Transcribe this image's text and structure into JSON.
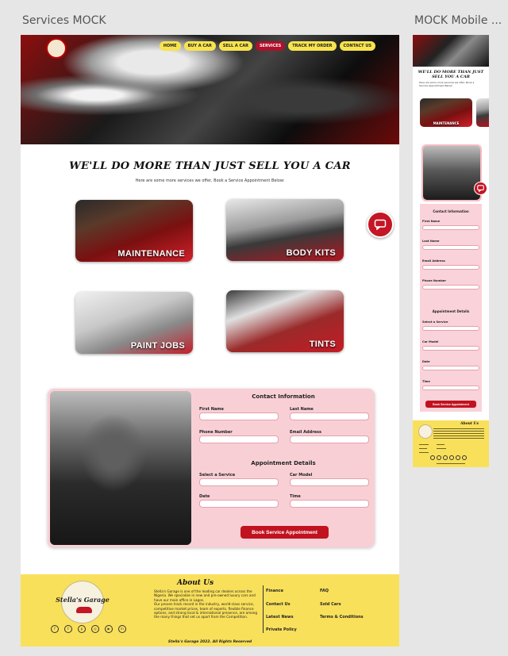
{
  "frames": {
    "desktop_title": "Services MOCK",
    "mobile_title": "MOCK Mobile ..."
  },
  "nav": {
    "items": [
      {
        "label": "HOME",
        "active": false
      },
      {
        "label": "BUY A CAR",
        "active": false
      },
      {
        "label": "SELL A CAR",
        "active": false
      },
      {
        "label": "SERVICES",
        "active": true
      },
      {
        "label": "TRACK MY ORDER",
        "active": false
      },
      {
        "label": "CONTACT US",
        "active": false
      }
    ]
  },
  "hero": {
    "headline": "WE'LL DO MORE THAN JUST SELL YOU A CAR",
    "subtext": "Here are some more services we offer, Book a Service Appointment Below:"
  },
  "services": [
    {
      "label": "MAINTENANCE"
    },
    {
      "label": "BODY KITS"
    },
    {
      "label": "PAINT JOBS"
    },
    {
      "label": "TINTS"
    }
  ],
  "form": {
    "contact_heading": "Contact Information",
    "appointment_heading": "Appointment Details",
    "first_name_label": "First Name",
    "last_name_label": "Last Name",
    "phone_label": "Phone Number",
    "email_label": "Email Address",
    "service_label": "Select a Service",
    "car_model_label": "Car Model",
    "date_label": "Date",
    "time_label": "Time",
    "submit_label": "Book Service Appointment"
  },
  "footer": {
    "logo_text": "Stella's Garage",
    "about_title": "About Us",
    "about_text_1": "Stella's Garage is one of the leading car dealers across the Nigeria. We specialize in new and pre-owned luxury cars and have our main office in Lagos.",
    "about_text_2": "Our proven track record in the industry, world-class service, competitive market prices, team of experts, flexible finance options, and strong local & international presence, are among the many things that set us apart from the Competition.",
    "links_col1": [
      "Finance",
      "Contact Us",
      "Latest News",
      "Private Policy"
    ],
    "links_col2": [
      "FAQ",
      "Sold Cars",
      "Terms & Conditions"
    ],
    "copyright": "Stella's Garage 2022. All Rights Reserved"
  },
  "mobile": {
    "headline": "WE'LL DO MORE THAN JUST SELL YOU A CAR",
    "subtext": "Here are some more services we offer, Book a Service Appointment Below:",
    "card_label": "MAINTENANCE",
    "about_title": "About Us"
  },
  "colors": {
    "accent_red": "#c1121f",
    "nav_yellow": "#f7e34e",
    "footer_yellow": "#f9e05b",
    "form_pink": "#f9cfd6"
  },
  "icons": {
    "chat": "chat-bubble-icon",
    "social": [
      "facebook-icon",
      "twitter-icon",
      "pinterest-icon",
      "instagram-icon",
      "youtube-icon",
      "linkedin-icon"
    ]
  }
}
